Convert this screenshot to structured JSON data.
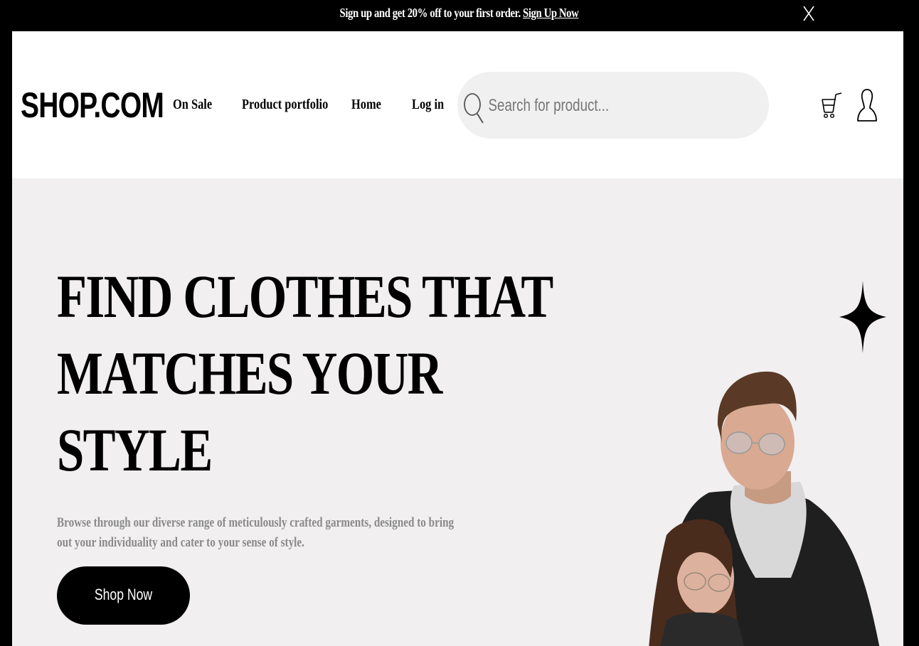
{
  "promo": {
    "text": "Sign up and get 20% off to your first order.",
    "link": "Sign Up Now",
    "close_icon": "close-icon"
  },
  "header": {
    "logo": "SHOP.COM",
    "nav": [
      "On Sale",
      "Product portfolio",
      "Home",
      "Log in"
    ],
    "search": {
      "placeholder": "Search for product...",
      "value": "",
      "icon": "search-icon"
    },
    "icons": [
      "cart-icon",
      "user-icon"
    ]
  },
  "hero": {
    "title_lines": [
      "FIND CLOTHES THAT",
      "MATCHES YOUR",
      "STYLE"
    ],
    "description": "Browse through our diverse range of meticulously crafted garments, designed to bring out your individuality and cater to your sense of style.",
    "cta": "Shop Now",
    "decoration_icon": "sparkle-icon"
  },
  "colors": {
    "promo_bg": "#000000",
    "hero_bg": "#f1eff0",
    "search_bg": "#f0f0f0",
    "button_bg": "#000000",
    "description_text": "#8a8a8a"
  }
}
